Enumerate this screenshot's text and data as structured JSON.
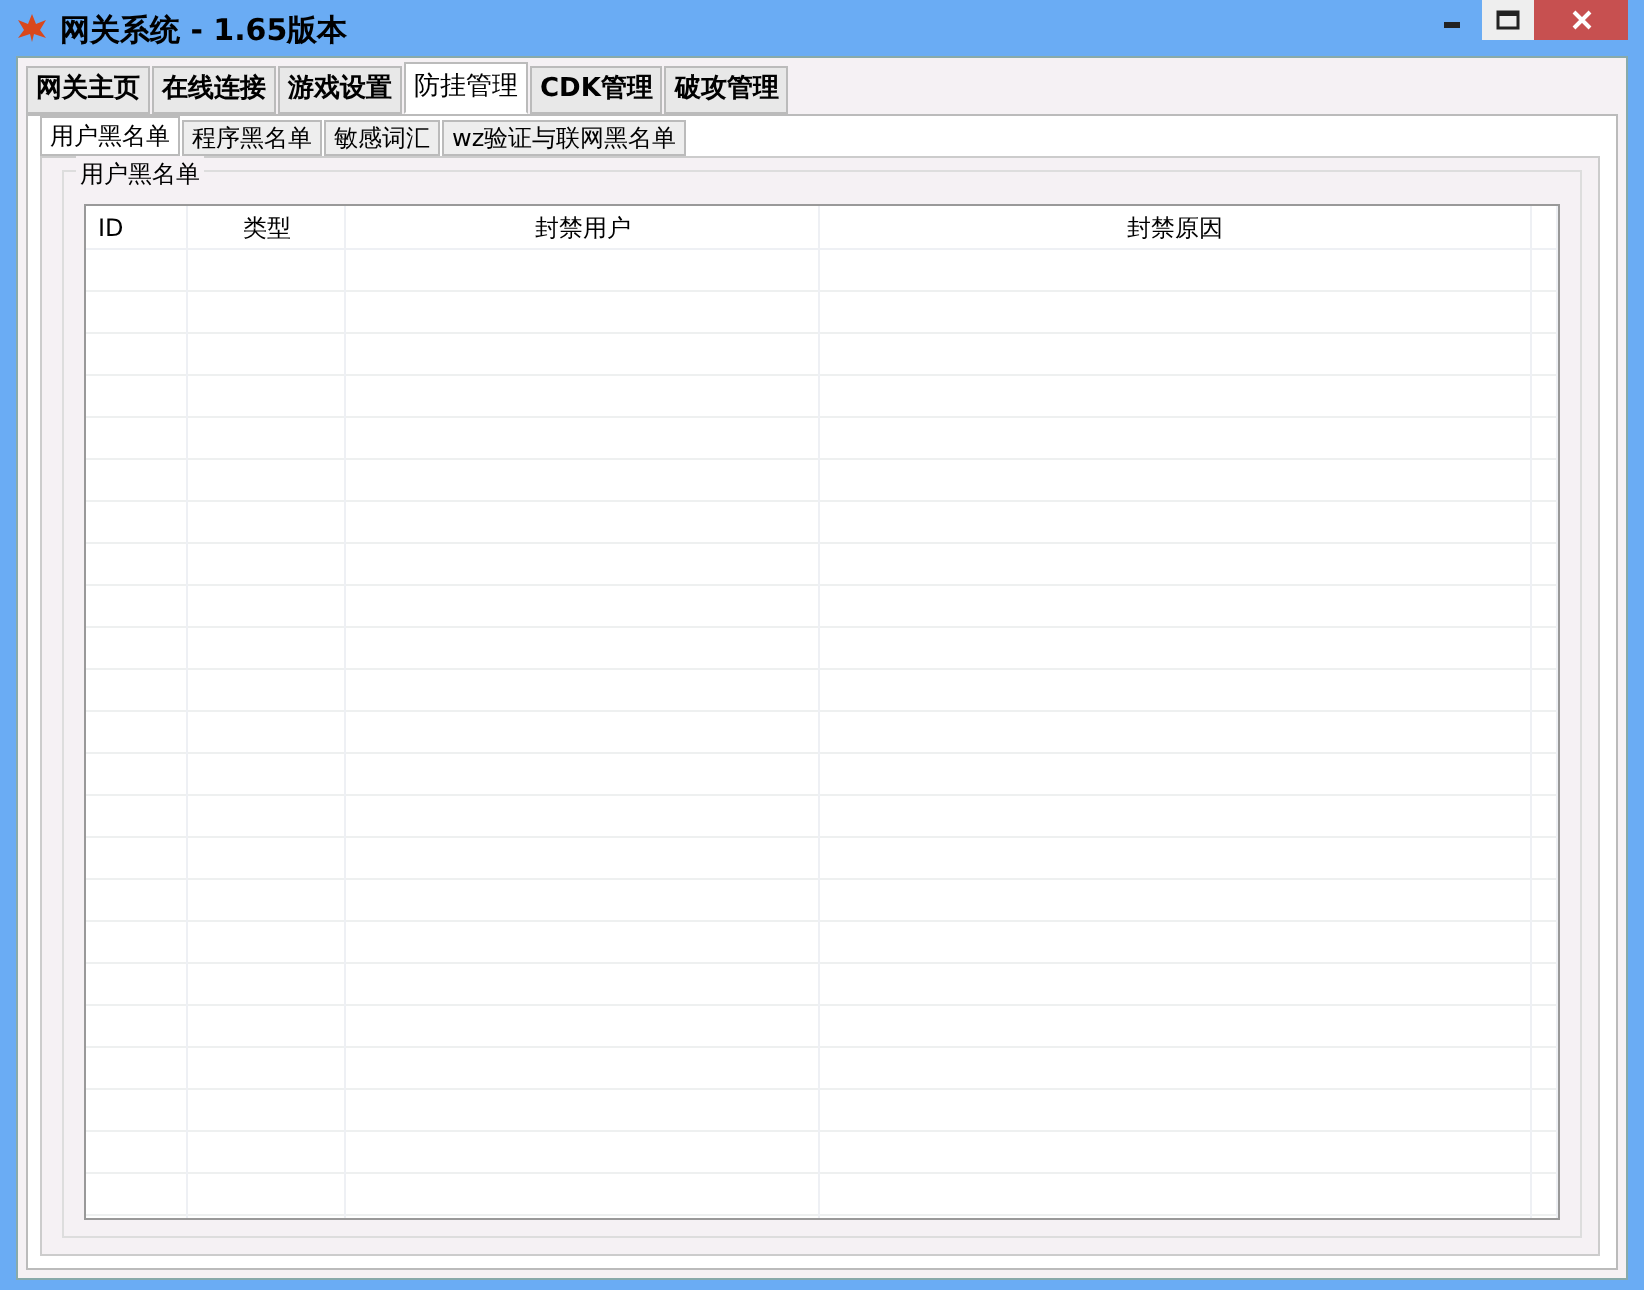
{
  "window": {
    "title": "网关系统 - 1.65版本"
  },
  "tabs": [
    {
      "label": "网关主页",
      "selected": false
    },
    {
      "label": "在线连接",
      "selected": false
    },
    {
      "label": "游戏设置",
      "selected": false
    },
    {
      "label": "防挂管理",
      "selected": true
    },
    {
      "label": "CDK管理",
      "selected": false
    },
    {
      "label": "破攻管理",
      "selected": false
    }
  ],
  "subtabs": [
    {
      "label": "用户黑名单",
      "selected": true
    },
    {
      "label": "程序黑名单",
      "selected": false
    },
    {
      "label": "敏感词汇",
      "selected": false
    },
    {
      "label": "wz验证与联网黑名单",
      "selected": false
    }
  ],
  "group": {
    "title": "用户黑名单"
  },
  "table": {
    "columns": [
      "ID",
      "类型",
      "封禁用户",
      "封禁原因"
    ]
  }
}
